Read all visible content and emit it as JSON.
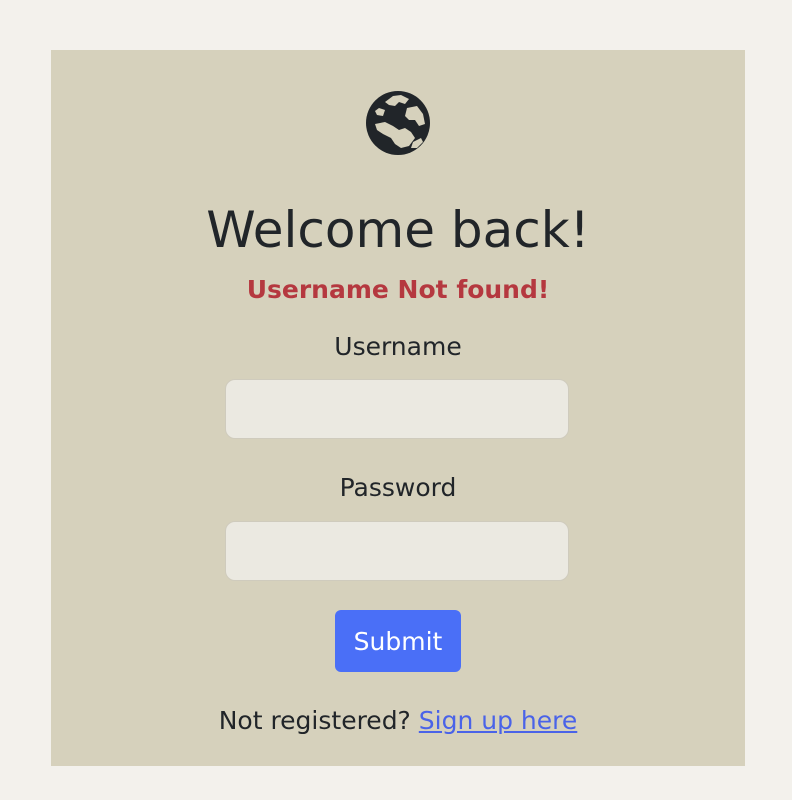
{
  "logo": {
    "icon": "globe-europe-africa-icon"
  },
  "heading": "Welcome back!",
  "error_message": "Username Not found!",
  "form": {
    "username_label": "Username",
    "username_value": "",
    "password_label": "Password",
    "password_value": "",
    "submit_label": "Submit"
  },
  "footer": {
    "prompt": "Not registered?",
    "link_text": "Sign up here"
  },
  "colors": {
    "page_background": "#f3f1ec",
    "card_background": "#d6d1bc",
    "error": "#b5383f",
    "primary_button": "#4a6ff7",
    "link": "#4a63e8"
  }
}
